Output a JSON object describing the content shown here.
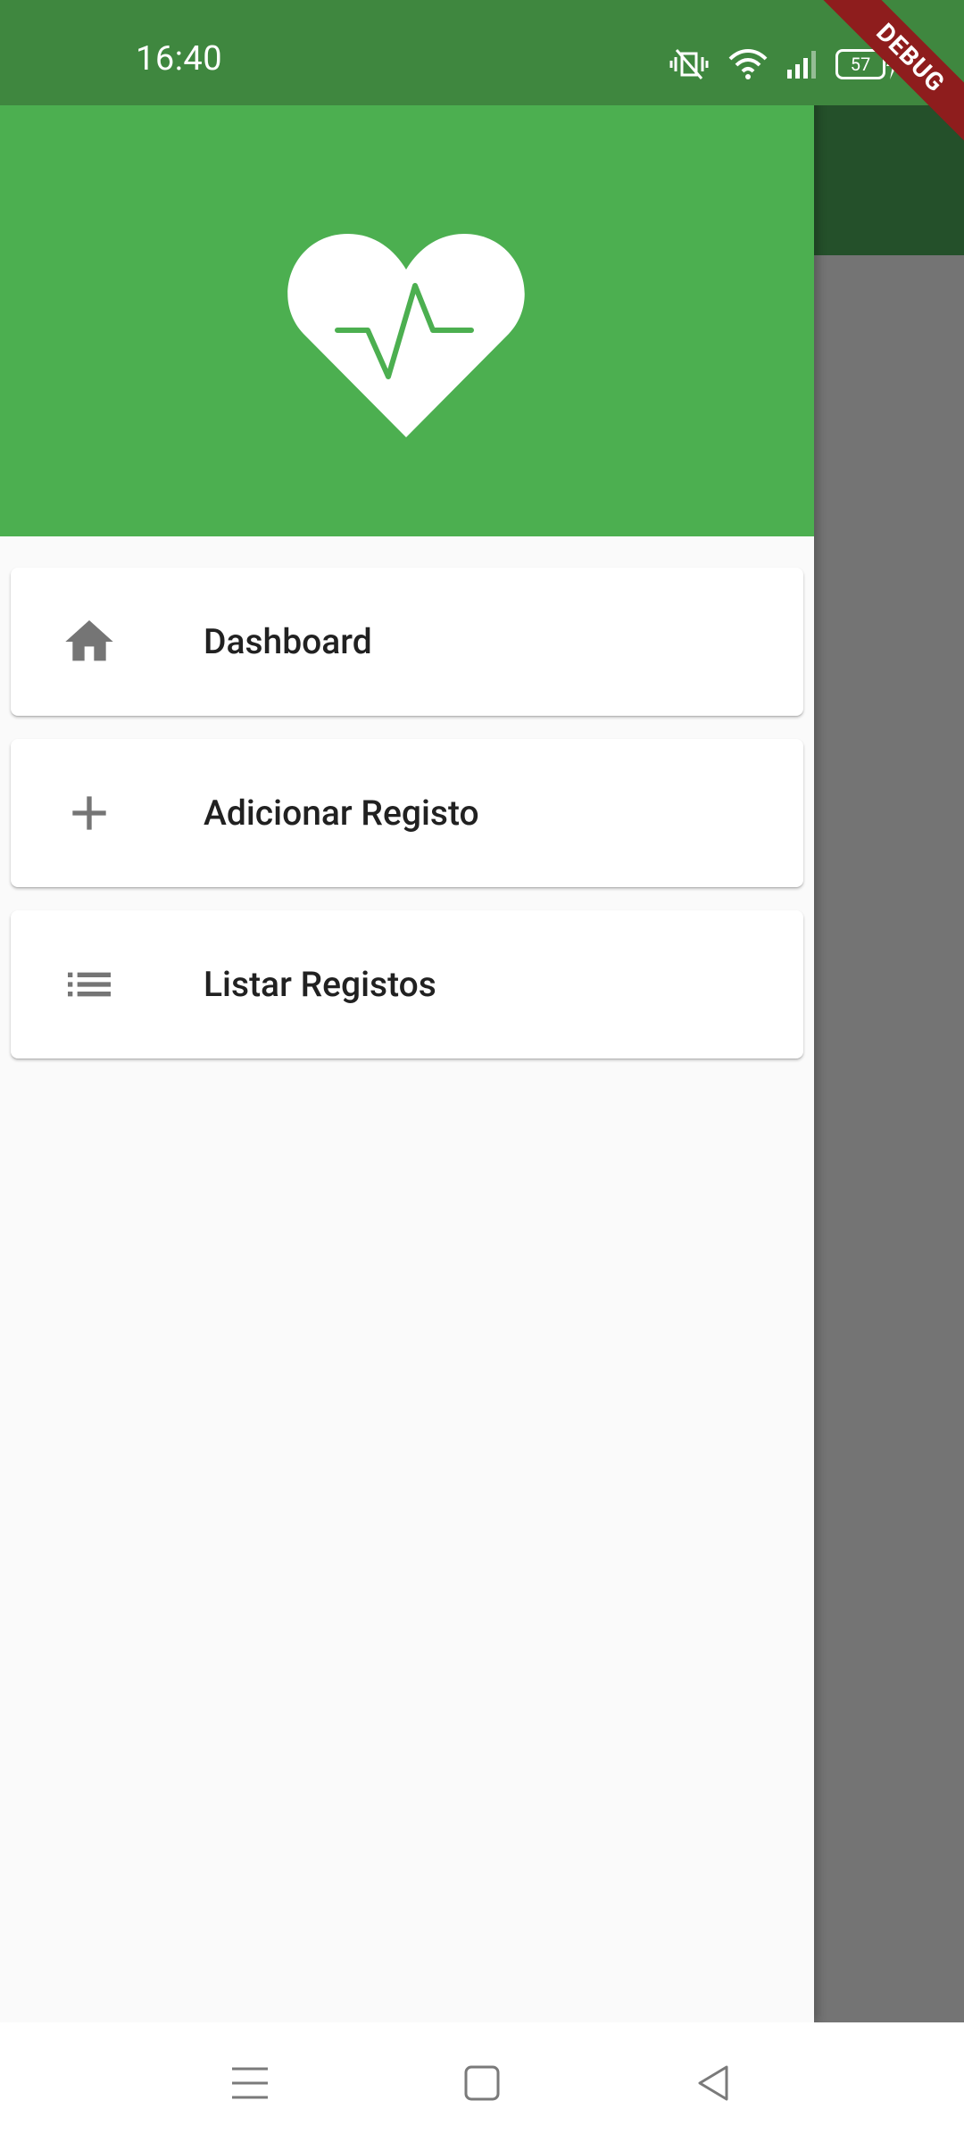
{
  "status_bar": {
    "time": "16:40",
    "battery": "57",
    "icons": [
      "vibrate-icon",
      "wifi-icon",
      "signal-icon",
      "battery-icon",
      "charging-icon"
    ]
  },
  "debug_banner": {
    "label": "DEBUG"
  },
  "drawer": {
    "header": {
      "logo_icon": "heart-pulse-icon"
    },
    "items": [
      {
        "label": "Dashboard",
        "icon": "home-icon"
      },
      {
        "label": "Adicionar Registo",
        "icon": "add-icon"
      },
      {
        "label": "Listar Registos",
        "icon": "list-icon"
      }
    ]
  },
  "nav_bar": {
    "buttons": [
      "menu-icon",
      "home-square-icon",
      "back-triangle-icon"
    ]
  },
  "colors": {
    "header_green": "#4caf50",
    "status_green": "#3f873f",
    "appbar_dark": "#24502a",
    "scrim": "#747474",
    "icon_gray": "#757575",
    "debug_red": "#8e1d1d"
  }
}
